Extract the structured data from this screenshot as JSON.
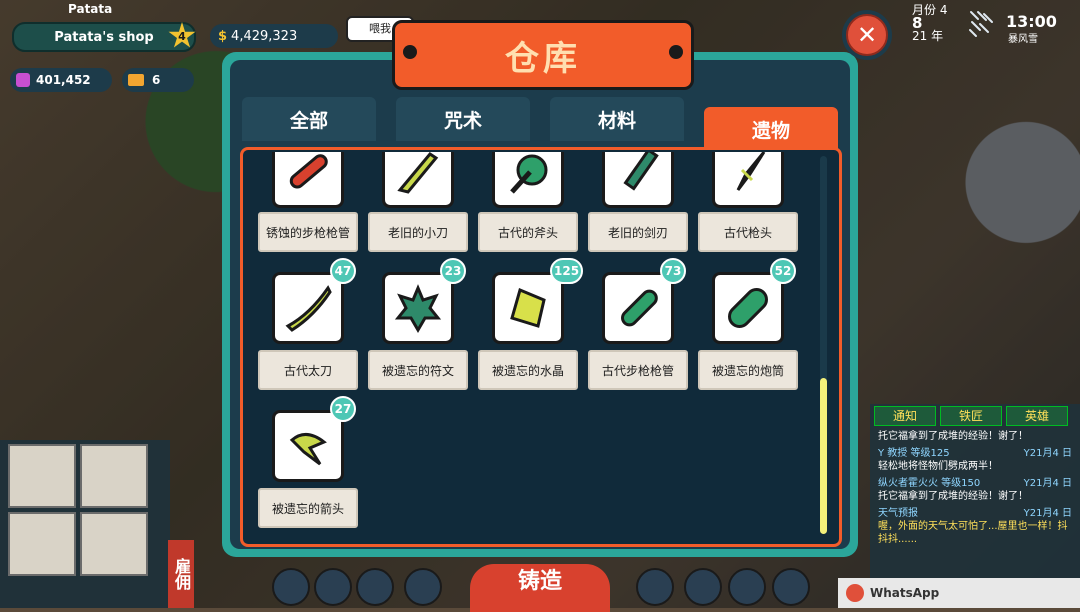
{
  "hud": {
    "player_name": "Patata",
    "shop_name": "Patata's shop",
    "shop_level": "4",
    "money": "4,429,323",
    "gems": "401,452",
    "tickets": "6",
    "speech_bubble": "喂我"
  },
  "status": {
    "month": "月份 4",
    "day": "8",
    "year": "21 年",
    "time": "13:00",
    "weather": "暴风雪"
  },
  "modal": {
    "title": "仓库",
    "tabs": [
      {
        "label": "全部",
        "active": false
      },
      {
        "label": "咒术",
        "active": false
      },
      {
        "label": "材料",
        "active": false
      },
      {
        "label": "遗物",
        "active": true
      }
    ]
  },
  "items": [
    {
      "name": "锈蚀的步枪枪管",
      "count": null,
      "icon": "rusty-barrel-icon"
    },
    {
      "name": "老旧的小刀",
      "count": null,
      "icon": "old-knife-icon"
    },
    {
      "name": "古代的斧头",
      "count": null,
      "icon": "ancient-axe-icon"
    },
    {
      "name": "老旧的剑刃",
      "count": null,
      "icon": "old-blade-icon"
    },
    {
      "name": "古代枪头",
      "count": null,
      "icon": "ancient-spearhead-icon"
    },
    {
      "name": "古代太刀",
      "count": "47",
      "icon": "ancient-tachi-icon"
    },
    {
      "name": "被遗忘的符文",
      "count": "23",
      "icon": "forgotten-rune-icon"
    },
    {
      "name": "被遗忘的水晶",
      "count": "125",
      "icon": "forgotten-crystal-icon"
    },
    {
      "name": "古代步枪枪管",
      "count": "73",
      "icon": "ancient-barrel-icon"
    },
    {
      "name": "被遗忘的炮筒",
      "count": "52",
      "icon": "forgotten-cannon-icon"
    },
    {
      "name": "被遗忘的箭头",
      "count": "27",
      "icon": "forgotten-arrowhead-icon"
    }
  ],
  "chat": {
    "tabs": [
      "通知",
      "铁匠",
      "英雄"
    ],
    "messages": [
      {
        "meta": "",
        "time": "",
        "body": "托它福拿到了成堆的经验！谢了！",
        "alert": false
      },
      {
        "meta": "Y 教授 等级125",
        "time": "Y21月4 日",
        "body": "轻松地将怪物们劈成两半！",
        "alert": false
      },
      {
        "meta": "纵火者霍火火 等级150",
        "time": "Y21月4 日",
        "body": "托它福拿到了成堆的经验！谢了！",
        "alert": false
      },
      {
        "meta": "天气预报",
        "time": "Y21月4 日",
        "body": "喔，外面的天气太可怕了...屋里也一样！抖抖抖......",
        "alert": true
      }
    ],
    "whatsapp_label": "WhatsApp"
  },
  "bottom": {
    "forge_label": "铸造",
    "hire_label": "雇佣"
  },
  "colors": {
    "accent": "#f25c2a",
    "frame": "#2ba69a",
    "panel": "#1c3c4c",
    "badge": "#4ec7b5",
    "scroll_thumb": "#f2f07a"
  }
}
